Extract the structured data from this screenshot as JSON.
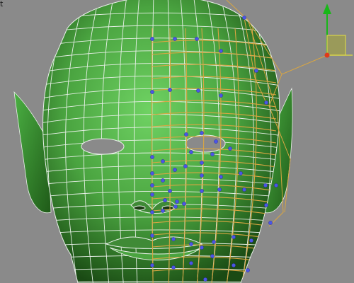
{
  "viewport": {
    "label": "t",
    "background": "#8a8a8a"
  },
  "model": {
    "mesh_color": "#56b84c",
    "wire_color": "#e8f0e8",
    "selected_edge_color": "#d9a642",
    "vertex_color": "#4b55e8"
  },
  "gizmo": {
    "axis_y_color": "#18b818",
    "pivot_color": "#e03a1a",
    "plane_fill": "#9a9a5a",
    "plane_outline": "#d6d24a",
    "icons": [
      "move-gizmo-y-arrow-icon",
      "move-gizmo-xy-plane-icon",
      "move-gizmo-pivot-icon"
    ]
  }
}
